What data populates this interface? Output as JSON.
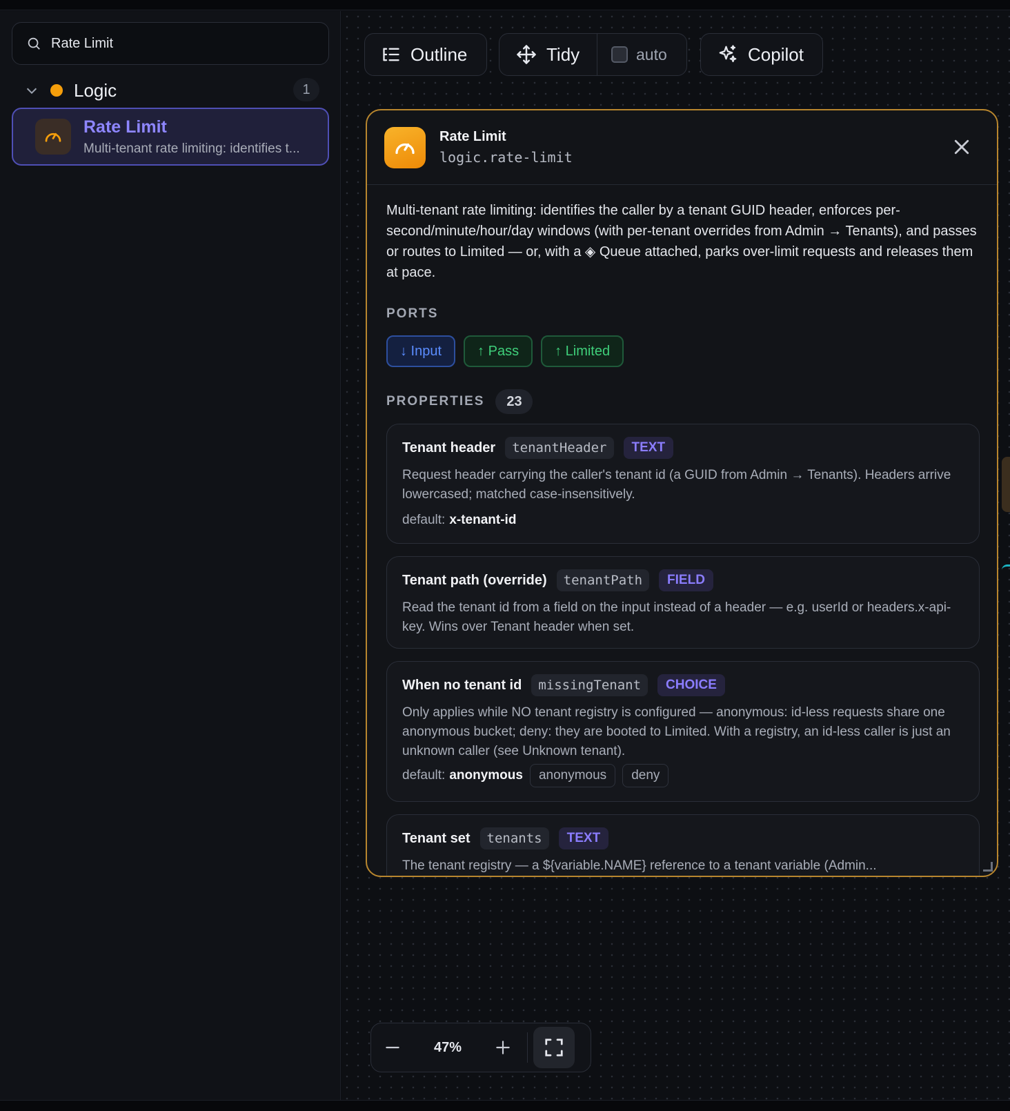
{
  "sidebar": {
    "search": {
      "value": "Rate Limit",
      "placeholder": ""
    },
    "group": {
      "name": "Logic",
      "count": "1",
      "dot_color": "#f59e0b"
    },
    "node": {
      "title": "Rate Limit",
      "description": "Multi-tenant rate limiting: identifies t..."
    }
  },
  "toolbar": {
    "outline": "Outline",
    "tidy": "Tidy",
    "auto": "auto",
    "copilot": "Copilot"
  },
  "panel": {
    "title": "Rate Limit",
    "type_id": "logic.rate-limit",
    "description": "Multi-tenant rate limiting: identifies the caller by a tenant GUID header, enforces per-second/minute/hour/day windows (with per-tenant overrides from Admin → Tenants), and passes or routes to Limited — or, with a ◈ Queue attached, parks over-limit requests and releases them at pace.",
    "ports_label": "PORTS",
    "ports": [
      {
        "label": "↓ Input",
        "kind": "input"
      },
      {
        "label": "↑ Pass",
        "kind": "output"
      },
      {
        "label": "↑ Limited",
        "kind": "output"
      }
    ],
    "properties_label": "PROPERTIES",
    "properties_count": "23",
    "default_label": "default:",
    "properties": [
      {
        "name": "Tenant header",
        "key": "tenantHeader",
        "type": "TEXT",
        "description": "Request header carrying the caller's tenant id (a GUID from Admin → Tenants). Headers arrive lowercased; matched case-insensitively.",
        "default": "x-tenant-id"
      },
      {
        "name": "Tenant path (override)",
        "key": "tenantPath",
        "type": "FIELD",
        "description": "Read the tenant id from a field on the input instead of a header — e.g. userId or headers.x-api-key. Wins over Tenant header when set."
      },
      {
        "name": "When no tenant id",
        "key": "missingTenant",
        "type": "CHOICE",
        "description": "Only applies while NO tenant registry is configured — anonymous: id-less requests share one anonymous bucket; deny: they are booted to Limited. With a registry, an id-less caller is just an unknown caller (see Unknown tenant).",
        "default": "anonymous",
        "options": [
          "anonymous",
          "deny"
        ]
      },
      {
        "name": "Tenant set",
        "key": "tenants",
        "type": "TEXT",
        "description": "The tenant registry — a ${variable.NAME} reference to a tenant variable (Admin..."
      }
    ]
  },
  "zoom": {
    "level": "47%"
  },
  "colors": {
    "accent": "#8e86ff",
    "panel_border": "#b8862e",
    "port_input": "#5b8dff",
    "port_output": "#3fcf7a"
  }
}
